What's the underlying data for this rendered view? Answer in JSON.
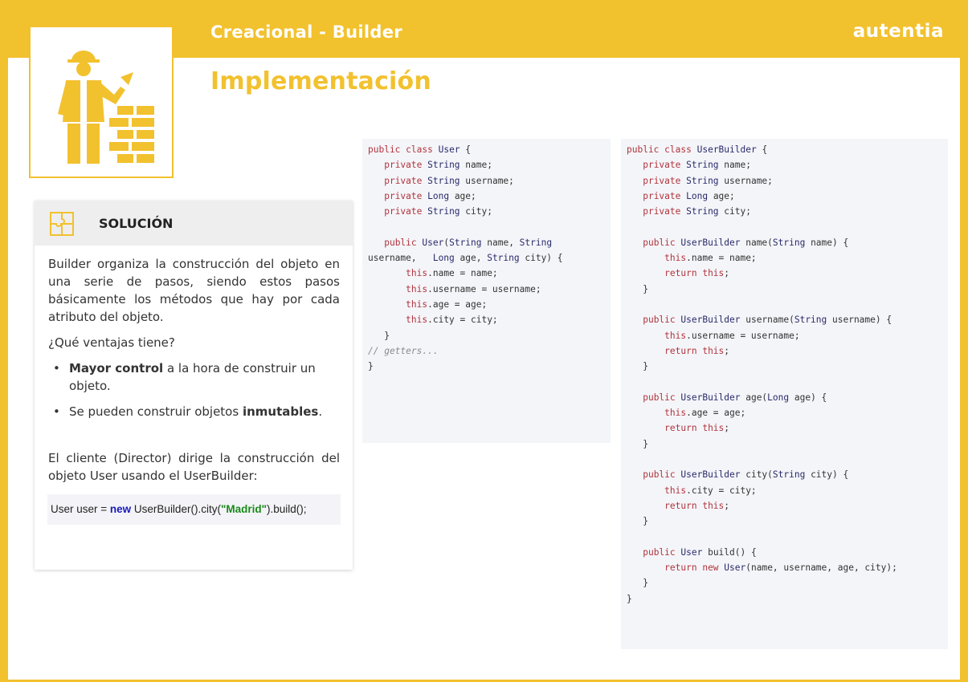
{
  "header": {
    "subtitle": "Creacional - Builder",
    "brand": "autentia",
    "title": "Implementación"
  },
  "colors": {
    "accent": "#f2c12e",
    "code_bg": "#f4f5f9"
  },
  "icons": {
    "logo": "builder-worker-icon",
    "solution": "puzzle-icon"
  },
  "solution_card": {
    "heading": "SOLUCIÓN",
    "intro": "Builder organiza la construcción del objeto en una serie de pasos, siendo estos pasos básicamente los métodos que hay por cada atributo del objeto.",
    "question": "¿Qué ventajas tiene?",
    "bullets": [
      {
        "bold": "Mayor control",
        "text": " a la hora de construir un objeto.",
        "bold_first": true
      },
      {
        "text": "Se pueden construir objetos ",
        "bold": "inmutables",
        "suffix": ".",
        "bold_first": false
      }
    ],
    "director_text": "El cliente (Director) dirige  la construcción del objeto User usando el UserBuilder:",
    "code": {
      "part1": "User user = ",
      "kw": "new",
      "part2": " UserBuilder().city(",
      "str": "\"Madrid\"",
      "part3": ").build();"
    }
  },
  "code_user": [
    "public class User {",
    "   private String name;",
    "   private String username;",
    "   private Long age;",
    "   private String city;",
    "",
    "   public User(String name, String",
    "username,   Long age, String city) {",
    "       this.name = name;",
    "       this.username = username;",
    "       this.age = age;",
    "       this.city = city;",
    "   }",
    "// getters...",
    "}"
  ],
  "code_builder": [
    "public class UserBuilder {",
    "   private String name;",
    "   private String username;",
    "   private Long age;",
    "   private String city;",
    "",
    "   public UserBuilder name(String name) {",
    "       this.name = name;",
    "       return this;",
    "   }",
    "",
    "   public UserBuilder username(String username) {",
    "       this.username = username;",
    "       return this;",
    "   }",
    "",
    "   public UserBuilder age(Long age) {",
    "       this.age = age;",
    "       return this;",
    "   }",
    "",
    "   public UserBuilder city(String city) {",
    "       this.city = city;",
    "       return this;",
    "   }",
    "",
    "   public User build() {",
    "       return new User(name, username, age, city);",
    "   }",
    "}"
  ]
}
